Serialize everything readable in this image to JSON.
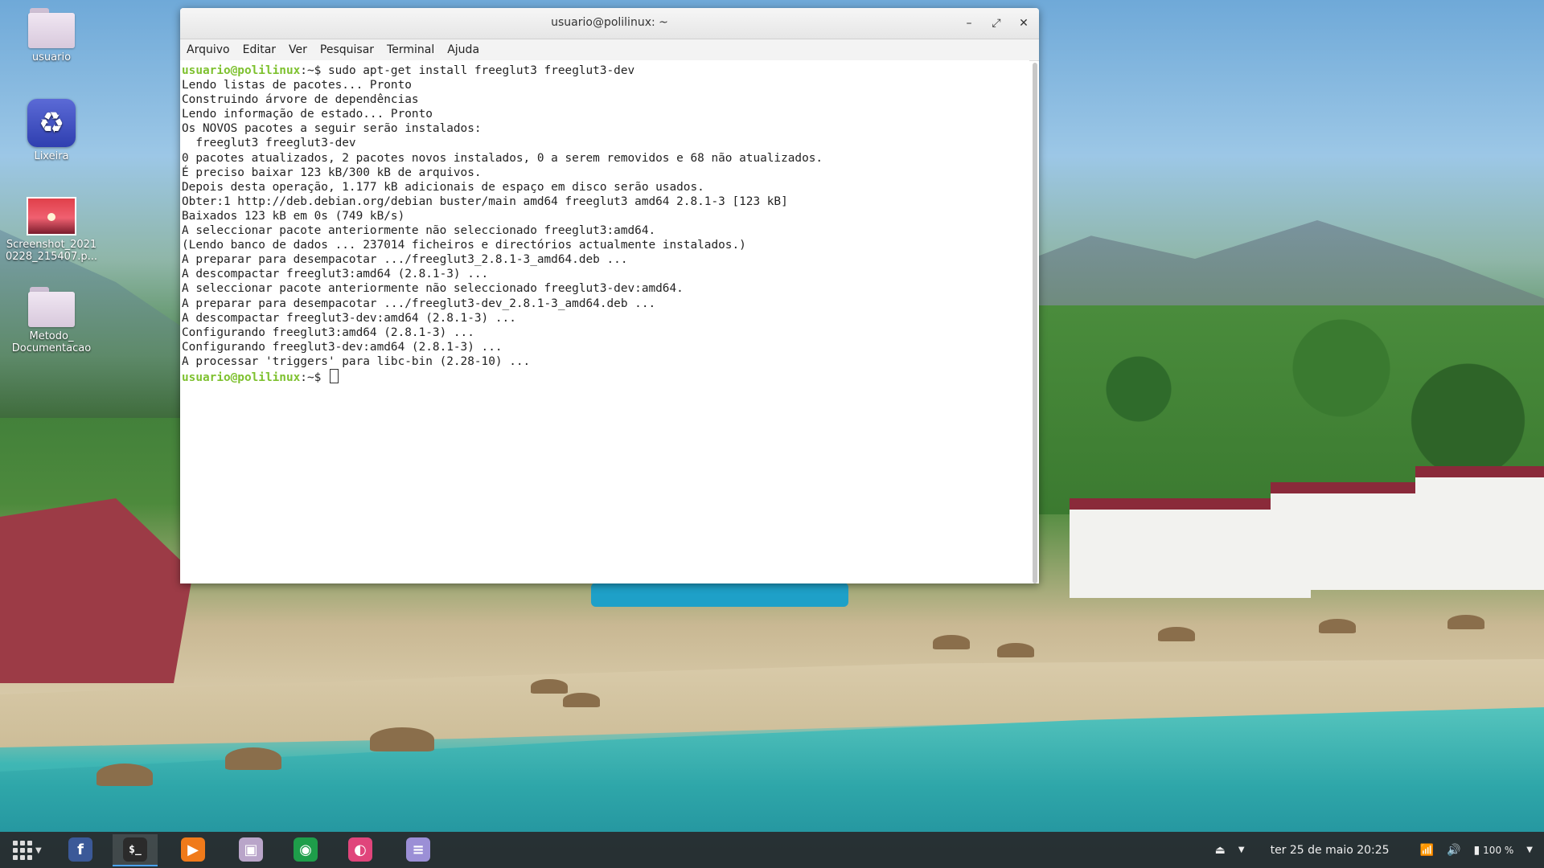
{
  "desktop": {
    "icons": [
      {
        "label": "usuario"
      },
      {
        "label": "Lixeira"
      },
      {
        "label": "Screenshot_2021​0228_215407.p..."
      },
      {
        "label": "Metodo_​Documentacao"
      }
    ]
  },
  "window": {
    "title": "usuario@polilinux: ~",
    "controls": {
      "minimize": "–",
      "maximize": "⤢",
      "close": "✕"
    },
    "menu": [
      "Arquivo",
      "Editar",
      "Ver",
      "Pesquisar",
      "Terminal",
      "Ajuda"
    ]
  },
  "terminal": {
    "prompt_user": "usuario@polilinux",
    "prompt_suffix": ":~$ ",
    "command": "sudo apt-get install freeglut3 freeglut3-dev",
    "output": [
      "Lendo listas de pacotes... Pronto",
      "Construindo árvore de dependências",
      "Lendo informação de estado... Pronto",
      "Os NOVOS pacotes a seguir serão instalados:",
      "  freeglut3 freeglut3-dev",
      "0 pacotes atualizados, 2 pacotes novos instalados, 0 a serem removidos e 68 não atualizados.",
      "É preciso baixar 123 kB/300 kB de arquivos.",
      "Depois desta operação, 1.177 kB adicionais de espaço em disco serão usados.",
      "Obter:1 http://deb.debian.org/debian buster/main amd64 freeglut3 amd64 2.8.1-3 [123 kB]",
      "Baixados 123 kB em 0s (749 kB/s)",
      "A seleccionar pacote anteriormente não seleccionado freeglut3:amd64.",
      "(Lendo banco de dados ... 237014 ficheiros e directórios actualmente instalados.)",
      "A preparar para desempacotar .../freeglut3_2.8.1-3_amd64.deb ...",
      "A descompactar freeglut3:amd64 (2.8.1-3) ...",
      "A seleccionar pacote anteriormente não seleccionado freeglut3-dev:amd64.",
      "A preparar para desempacotar .../freeglut3-dev_2.8.1-3_amd64.deb ...",
      "A descompactar freeglut3-dev:amd64 (2.8.1-3) ...",
      "Configurando freeglut3:amd64 (2.8.1-3) ...",
      "Configurando freeglut3-dev:amd64 (2.8.1-3) ...",
      "A processar 'triggers' para libc-bin (2.28-10) ..."
    ]
  },
  "taskbar": {
    "apps": [
      {
        "name": "facebook",
        "glyph": "f",
        "color": "#3b5998"
      },
      {
        "name": "terminal",
        "glyph": "$_",
        "color": "#2b2b2b"
      },
      {
        "name": "media-player",
        "glyph": "▶",
        "color": "#f07a1a"
      },
      {
        "name": "files",
        "glyph": "▣",
        "color": "#b9a5c9"
      },
      {
        "name": "chrome-like",
        "glyph": "◉",
        "color": "#1e9e4a"
      },
      {
        "name": "color-picker",
        "glyph": "◐",
        "color": "#e0457b"
      },
      {
        "name": "text-editor",
        "glyph": "≡",
        "color": "#9b8fd6"
      }
    ],
    "clock": "ter 25 de maio  20:25",
    "battery": "100 %"
  }
}
